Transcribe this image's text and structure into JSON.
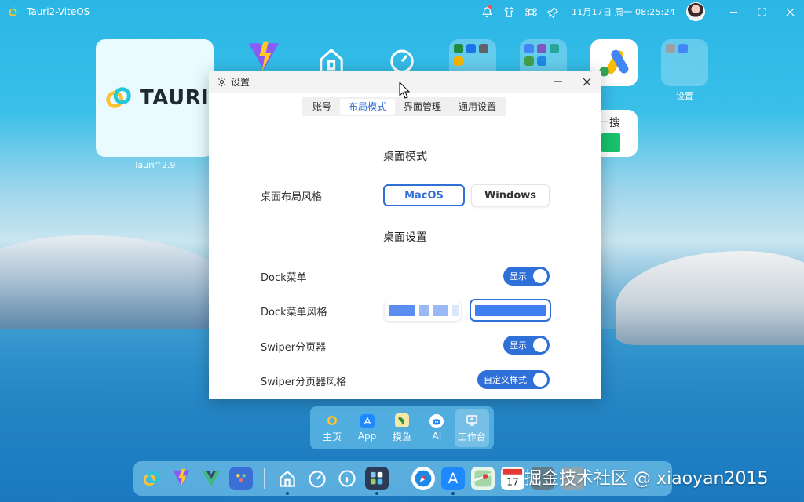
{
  "topbar": {
    "title": "Tauri2-ViteOS",
    "clock": "11月17日 周一 08:25:24"
  },
  "desktop": {
    "tauri_tile_label": "Tauri^2.9",
    "tauri_tile_text": "TAURI",
    "settings_tile_label": "设置",
    "partial_tile_text": "一搜"
  },
  "settings": {
    "title": "设置",
    "tabs": [
      "账号",
      "布局模式",
      "界面管理",
      "通用设置"
    ],
    "active_tab": 1,
    "section_desktop_mode": "桌面模式",
    "label_layout_style": "桌面布局风格",
    "btn_macos": "MacOS",
    "btn_windows": "Windows",
    "section_desktop_settings": "桌面设置",
    "label_dock_menu": "Dock菜单",
    "toggle_dock_menu": "显示",
    "label_dock_style": "Dock菜单风格",
    "label_swiper": "Swiper分页器",
    "toggle_swiper": "显示",
    "label_swiper_style": "Swiper分页器风格",
    "toggle_swiper_style": "自定义样式"
  },
  "mini_dock": {
    "items": [
      "主页",
      "App",
      "摸鱼",
      "AI",
      "工作台"
    ],
    "active": 4
  },
  "watermark": "掘金技术社区 @ xiaoyan2015",
  "colors": {
    "accent": "#2f6fd8",
    "sky": "#2bb6e6"
  }
}
